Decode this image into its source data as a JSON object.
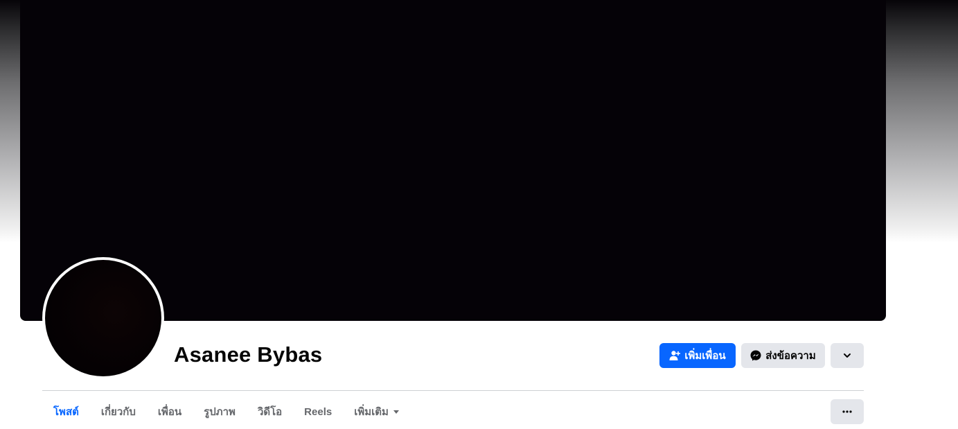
{
  "profile": {
    "name": "Asanee Bybas",
    "cover_color": "#050207",
    "avatar_color": "#050103"
  },
  "actions": {
    "add_friend_label": "เพิ่มเพื่อน",
    "message_label": "ส่งข้อความ",
    "add_friend_icon": "add-friend-icon",
    "message_icon": "messenger-icon",
    "dropdown_icon": "chevron-down-icon",
    "accent": "#0866ff"
  },
  "tabs": [
    {
      "label": "โพสต์",
      "active": true
    },
    {
      "label": "เกี่ยวกับ"
    },
    {
      "label": "เพื่อน"
    },
    {
      "label": "รูปภาพ"
    },
    {
      "label": "วิดีโอ"
    },
    {
      "label": "Reels"
    },
    {
      "label": "เพิ่มเติม",
      "has_caret": true
    }
  ],
  "tab_more_options_icon": "more-horizontal-icon"
}
